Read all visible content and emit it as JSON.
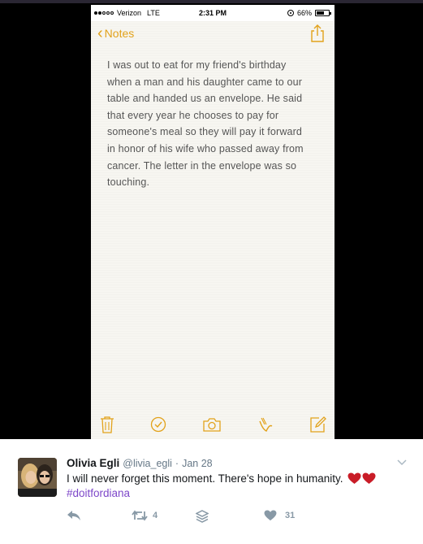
{
  "phone": {
    "status_bar": {
      "carrier": "Verizon",
      "network": "LTE",
      "time": "2:31 PM",
      "battery": "66%",
      "battery_level": 0.66,
      "signal_bars_filled": 2,
      "signal_bars_total": 5
    },
    "navbar": {
      "back_label": "Notes",
      "back_icon": "chevron-left-icon",
      "share_icon": "share-icon"
    },
    "note": {
      "lines": [
        "I was out to eat for my friend's birthday",
        "when a man and his daughter came to our",
        "table and handed us an envelope. He said",
        "that every year he chooses to pay for",
        "someone's meal so they will pay it forward",
        "in honor of his wife who passed away from",
        "cancer. The letter in the envelope was so",
        "touching."
      ]
    },
    "toolbar": {
      "icons": [
        "trash-icon",
        "checklist-icon",
        "camera-icon",
        "sketch-icon",
        "compose-icon"
      ]
    },
    "accent_color": "#e2a21b"
  },
  "tweet": {
    "name": "Olivia Egli",
    "handle": "@livia_egli",
    "separator": "·",
    "date": "Jan 28",
    "text": "I will never forget this moment. There's hope in humanity.",
    "emoji": "two red hearts",
    "hashtag": "#doitfordiana",
    "retweets": "4",
    "likes": "31",
    "hashtag_color": "#7d47c9"
  }
}
